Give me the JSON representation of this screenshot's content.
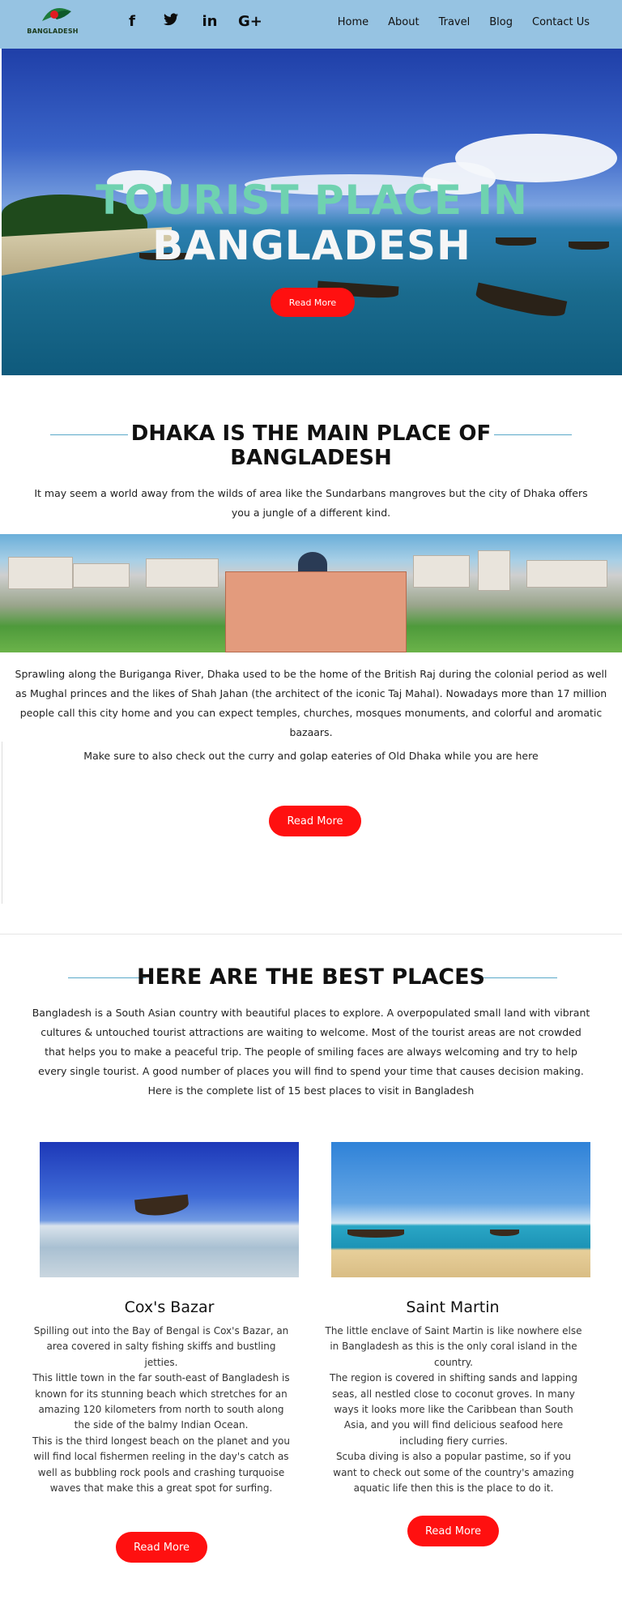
{
  "nav": {
    "logo_text": "BANGLADESH",
    "social": [
      {
        "icon": "facebook-icon",
        "glyph": "f"
      },
      {
        "icon": "twitter-icon",
        "glyph": "❖"
      },
      {
        "icon": "linkedin-icon",
        "glyph": "in"
      },
      {
        "icon": "google-plus-icon",
        "glyph": "G+"
      }
    ],
    "menu": [
      "Home",
      "About",
      "Travel",
      "Blog",
      "Contact Us"
    ]
  },
  "hero": {
    "title_line1": "TOURIST PLACE IN",
    "title_line2": "BANGLADESH",
    "button_label": "Read More"
  },
  "dhaka": {
    "heading_line1": "DHAKA IS THE MAIN PLACE OF",
    "heading_line2": "BANGLADESH",
    "intro": "It may seem a world away from the wilds of area like the Sundarbans mangroves but the city of Dhaka offers you a jungle of a different kind.",
    "body": "Sprawling along the Buriganga River, Dhaka used to be the home of the British Raj during the colonial period as well as Mughal princes and the likes of Shah Jahan (the architect of the iconic Taj Mahal). Nowadays more than 17 million people call this city home and you can expect temples, churches, mosques monuments, and colorful and aromatic bazaars.",
    "tip": "Make sure to also check out the curry and golap eateries of Old Dhaka while you are here",
    "button_label": "Read More"
  },
  "best": {
    "heading": "HERE ARE THE BEST PLACES",
    "intro": "Bangladesh is a South Asian country with beautiful places to explore. A overpopulated small land with vibrant cultures & untouched tourist attractions are waiting to welcome. Most of the tourist areas are not crowded that helps you to make a peaceful trip. The people of smiling faces are always welcoming and try to help every single tourist. A good number of places you will find to spend your time that causes decision making. Here is the complete list of 15 best places to visit in Bangladesh"
  },
  "cards": [
    {
      "title": "Cox's Bazar",
      "text": "Spilling out into the Bay of Bengal is Cox's Bazar, an area covered in salty fishing skiffs and bustling jetties.\nThis little town in the far south-east of Bangladesh is known for its stunning beach which stretches for an amazing 120 kilometers from north to south along the side of the balmy Indian Ocean.\nThis is the third longest beach on the planet and you will find local fishermen reeling in the day's catch as well as bubbling rock pools and crashing turquoise waves that make this a great spot for surfing.",
      "button_label": "Read More"
    },
    {
      "title": "Saint Martin",
      "text": "The little enclave of Saint Martin is like nowhere else in Bangladesh as this is the only coral island in the country.\nThe region is covered in shifting sands and lapping seas, all nestled close to coconut groves. In many ways it looks more like the Caribbean than South Asia, and you will find delicious seafood here including fiery curries.\nScuba diving is also a popular pastime, so if you want to check out some of the country's amazing aquatic life then this is the place to do it.",
      "button_label": "Read More"
    }
  ],
  "colors": {
    "nav_bg": "#96c3e2",
    "accent_red": "#ff1010",
    "hero_title_green": "#6fd2b0",
    "rule_blue": "#5aa9c9"
  }
}
